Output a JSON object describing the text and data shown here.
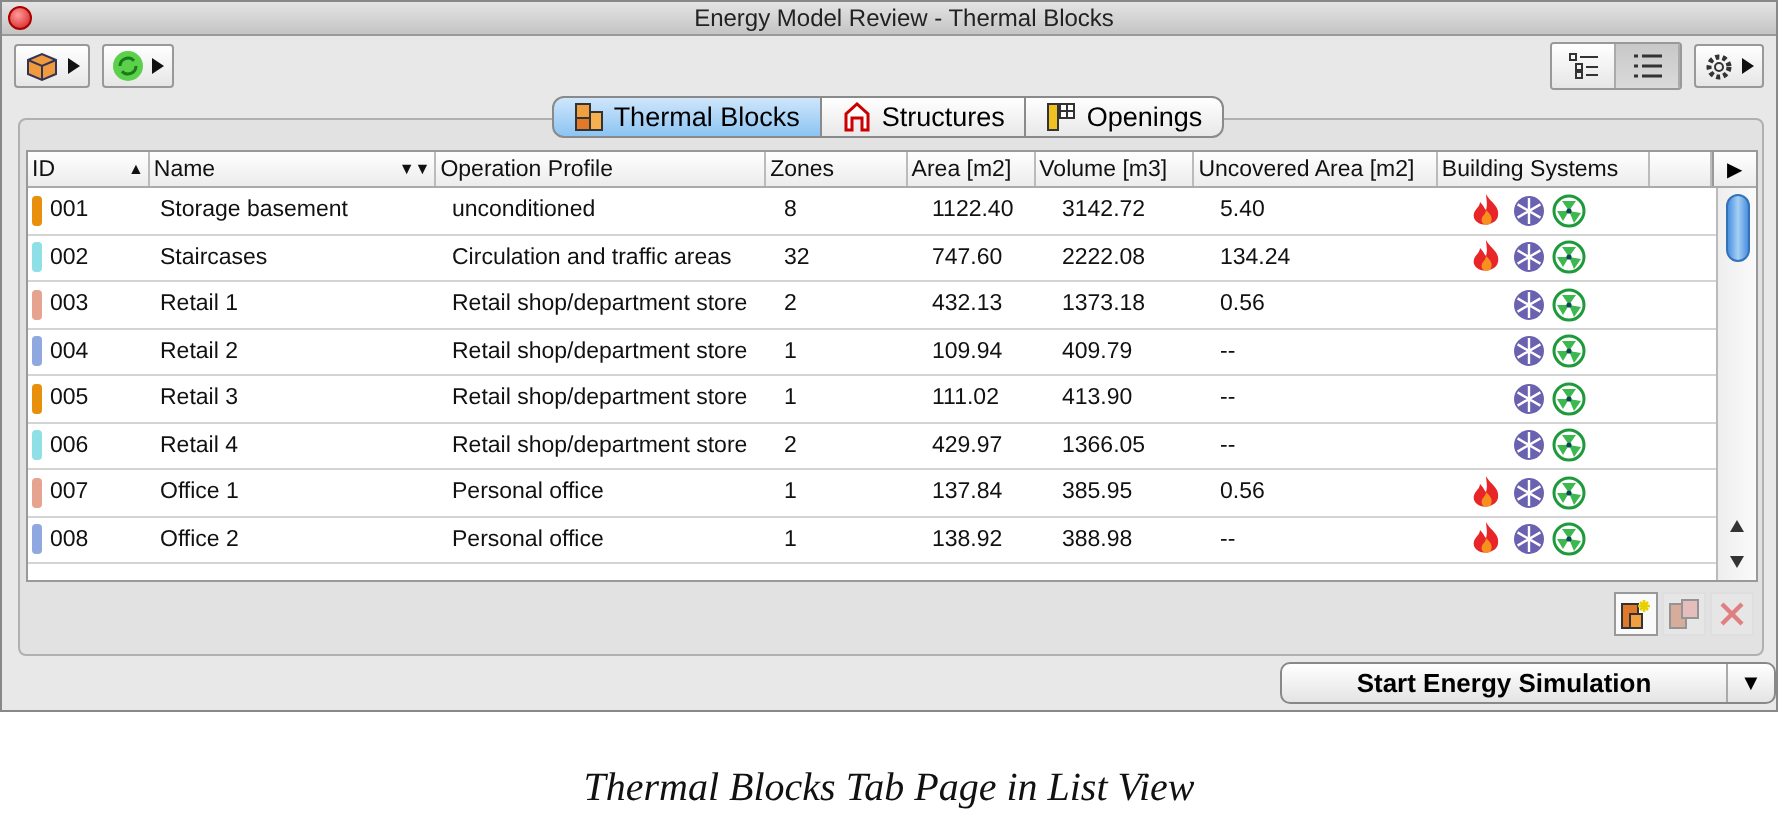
{
  "window": {
    "title": "Energy Model Review - Thermal Blocks"
  },
  "view_buttons": [
    {
      "kind": "tree",
      "selected": false
    },
    {
      "kind": "list",
      "selected": true
    }
  ],
  "tabs": [
    {
      "label": "Thermal Blocks",
      "kind": "blocks",
      "selected": true
    },
    {
      "label": "Structures",
      "kind": "house",
      "selected": false
    },
    {
      "label": "Openings",
      "kind": "openings",
      "selected": false
    }
  ],
  "table": {
    "columns": [
      {
        "label": "ID",
        "sort_mark": "▲"
      },
      {
        "label": "Name",
        "sort_mark": "▼▼"
      },
      {
        "label": "Operation Profile"
      },
      {
        "label": "Zones"
      },
      {
        "label": "Area [m2]"
      },
      {
        "label": "Volume [m3]"
      },
      {
        "label": "Uncovered Area [m2]"
      },
      {
        "label": "Building Systems"
      }
    ],
    "column_end": "▶",
    "rows": [
      {
        "color": "#e8900c",
        "id": "001",
        "name": "Storage basement",
        "profile": "unconditioned",
        "zones": "8",
        "area": "1122.40",
        "volume": "3142.72",
        "uncovered": "5.40",
        "heating": true,
        "cooling": true,
        "ventilation": true
      },
      {
        "color": "#8ee0e6",
        "id": "002",
        "name": "Staircases",
        "profile": "Circulation and traffic areas",
        "zones": "32",
        "area": "747.60",
        "volume": "2222.08",
        "uncovered": "134.24",
        "heating": true,
        "cooling": true,
        "ventilation": true
      },
      {
        "color": "#e6a38f",
        "id": "003",
        "name": "Retail 1",
        "profile": "Retail shop/department store",
        "zones": "2",
        "area": "432.13",
        "volume": "1373.18",
        "uncovered": "0.56",
        "heating": false,
        "cooling": true,
        "ventilation": true
      },
      {
        "color": "#8fa8e0",
        "id": "004",
        "name": "Retail 2",
        "profile": "Retail shop/department store",
        "zones": "1",
        "area": "109.94",
        "volume": "409.79",
        "uncovered": "--",
        "heating": false,
        "cooling": true,
        "ventilation": true
      },
      {
        "color": "#e8900c",
        "id": "005",
        "name": "Retail 3",
        "profile": "Retail shop/department store",
        "zones": "1",
        "area": "111.02",
        "volume": "413.90",
        "uncovered": "--",
        "heating": false,
        "cooling": true,
        "ventilation": true
      },
      {
        "color": "#8ee0e6",
        "id": "006",
        "name": "Retail 4",
        "profile": "Retail shop/department store",
        "zones": "2",
        "area": "429.97",
        "volume": "1366.05",
        "uncovered": "--",
        "heating": false,
        "cooling": true,
        "ventilation": true
      },
      {
        "color": "#e6a38f",
        "id": "007",
        "name": "Office 1",
        "profile": "Personal office",
        "zones": "1",
        "area": "137.84",
        "volume": "385.95",
        "uncovered": "0.56",
        "heating": true,
        "cooling": true,
        "ventilation": true
      },
      {
        "color": "#8fa8e0",
        "id": "008",
        "name": "Office 2",
        "profile": "Personal office",
        "zones": "1",
        "area": "138.92",
        "volume": "388.98",
        "uncovered": "--",
        "heating": true,
        "cooling": true,
        "ventilation": true
      }
    ]
  },
  "action_buttons": [
    {
      "kind": "add",
      "disabled": false
    },
    {
      "kind": "duplicate",
      "disabled": true
    },
    {
      "kind": "delete",
      "disabled": true
    }
  ],
  "simulation_button": {
    "label": "Start Energy Simulation",
    "menu_mark": "▼"
  },
  "caption": "Thermal Blocks Tab Page in List View"
}
